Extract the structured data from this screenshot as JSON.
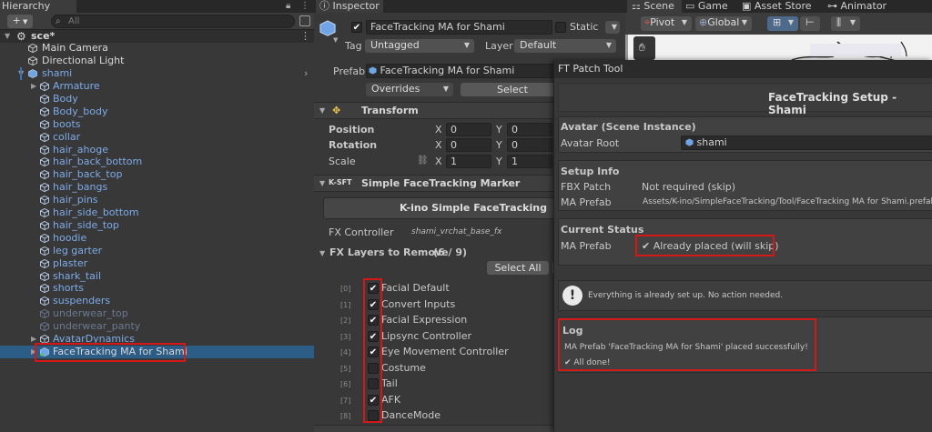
{
  "hierarchy": {
    "tab_label": "Hierarchy",
    "add_label": "+",
    "search_placeholder": "All",
    "scene_name": "sce*",
    "top_items": [
      "Main Camera",
      "Directional Light"
    ],
    "root_object": "shami",
    "children": [
      {
        "label": "Armature",
        "state": "foldout"
      },
      {
        "label": "Body",
        "state": "normal"
      },
      {
        "label": "Body_body",
        "state": "normal"
      },
      {
        "label": "boots",
        "state": "normal"
      },
      {
        "label": "collar",
        "state": "normal"
      },
      {
        "label": "hair_ahoge",
        "state": "normal"
      },
      {
        "label": "hair_back_bottom",
        "state": "normal"
      },
      {
        "label": "hair_back_top",
        "state": "normal"
      },
      {
        "label": "hair_bangs",
        "state": "normal"
      },
      {
        "label": "hair_pins",
        "state": "normal"
      },
      {
        "label": "hair_side_bottom",
        "state": "normal"
      },
      {
        "label": "hair_side_top",
        "state": "normal"
      },
      {
        "label": "hoodie",
        "state": "normal"
      },
      {
        "label": "leg garter",
        "state": "normal"
      },
      {
        "label": "plaster",
        "state": "normal"
      },
      {
        "label": "shark_tail",
        "state": "normal"
      },
      {
        "label": "shorts",
        "state": "normal"
      },
      {
        "label": "suspenders",
        "state": "normal"
      },
      {
        "label": "underwear_top",
        "state": "disabled"
      },
      {
        "label": "underwear_panty",
        "state": "disabled"
      },
      {
        "label": "AvatarDynamics",
        "state": "foldout"
      },
      {
        "label": "FaceTracking MA for Shami",
        "state": "selected"
      }
    ]
  },
  "inspector": {
    "tab_label": "Inspector",
    "object_name": "FaceTracking MA for Shami",
    "static_label": "Static",
    "tag_label": "Tag",
    "tag_value": "Untagged",
    "layer_label": "Layer",
    "layer_value": "Default",
    "prefab_label": "Prefab",
    "prefab_value": "FaceTracking MA for Shami",
    "overrides_label": "Overrides",
    "select_label": "Select",
    "transform": {
      "title": "Transform",
      "position_label": "Position",
      "rotation_label": "Rotation",
      "scale_label": "Scale",
      "position": {
        "x": "0",
        "y": "0"
      },
      "rotation": {
        "x": "0",
        "y": "0"
      },
      "scale": {
        "x": "1",
        "y": "1"
      }
    },
    "marker": {
      "logo": "K-SFT",
      "title": "Simple FaceTracking Marker",
      "banner": "K-ino Simple FaceTracking",
      "fx_label": "FX Controller",
      "fx_value": "shami_vrchat_base_fx",
      "layers_label": "FX Layers to Remove",
      "layers_count": "(6 / 9)",
      "select_all_label": "Select All",
      "layers": [
        {
          "index": "[0]",
          "name": "Facial Default",
          "checked": true
        },
        {
          "index": "[1]",
          "name": "Convert Inputs",
          "checked": true
        },
        {
          "index": "[2]",
          "name": "Facial Expression",
          "checked": true
        },
        {
          "index": "[3]",
          "name": "Lipsync Controller",
          "checked": true
        },
        {
          "index": "[4]",
          "name": "Eye Movement Controller",
          "checked": true
        },
        {
          "index": "[5]",
          "name": "Costume",
          "checked": false
        },
        {
          "index": "[6]",
          "name": "Tail",
          "checked": false
        },
        {
          "index": "[7]",
          "name": "AFK",
          "checked": true
        },
        {
          "index": "[8]",
          "name": "DanceMode",
          "checked": false
        }
      ]
    }
  },
  "scene": {
    "tabs": [
      "Scene",
      "Game",
      "Asset Store",
      "Animator"
    ],
    "pivot_label": "Pivot",
    "global_label": "Global"
  },
  "ft_tool": {
    "window_title": "FT Patch Tool",
    "header": "FaceTracking Setup - Shami",
    "avatar_section": "Avatar (Scene Instance)",
    "avatar_root_label": "Avatar Root",
    "avatar_root_value": "shami",
    "setup_section": "Setup Info",
    "fbx_label": "FBX Patch",
    "fbx_value": "Not required (skip)",
    "ma_prefab_label": "MA Prefab",
    "ma_prefab_path": "Assets/K-ino/SimpleFaceTracking/Tool/FaceTracking MA for Shami.prefab",
    "status_section": "Current Status",
    "status_label": "MA Prefab",
    "status_value": "✔ Already placed (will skip)",
    "info_message": "Everything is already set up. No action needed.",
    "log_section": "Log",
    "log_lines": [
      "MA Prefab 'FaceTracking MA for Shami' placed successfully!",
      "✔ All done!"
    ]
  },
  "colors": {
    "accent_blue": "#7dabe8",
    "success_green": "#6bd14b",
    "highlight_red": "#d41818"
  }
}
